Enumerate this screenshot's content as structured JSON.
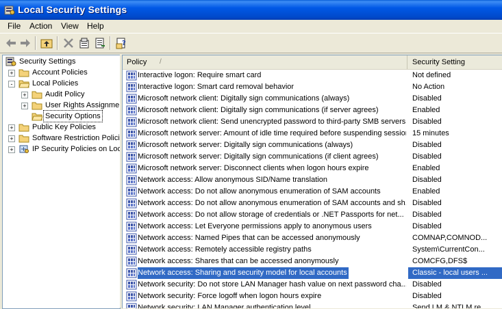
{
  "window": {
    "title": "Local Security Settings"
  },
  "menu": [
    "File",
    "Action",
    "View",
    "Help"
  ],
  "toolbar": [
    "back-icon",
    "forward-icon",
    "up-one-level-icon",
    "delete-icon",
    "properties-icon",
    "export-list-icon",
    "help-icon"
  ],
  "tree": [
    {
      "label": "Security Settings",
      "level": 0,
      "expander": ""
    },
    {
      "label": "Account Policies",
      "level": 1,
      "expander": "+"
    },
    {
      "label": "Local Policies",
      "level": 1,
      "expander": "-"
    },
    {
      "label": "Audit Policy",
      "level": 2,
      "expander": "+"
    },
    {
      "label": "User Rights Assignment",
      "level": 2,
      "expander": "+"
    },
    {
      "label": "Security Options",
      "level": 2,
      "expander": "",
      "selected": true
    },
    {
      "label": "Public Key Policies",
      "level": 1,
      "expander": "+"
    },
    {
      "label": "Software Restriction Policies",
      "level": 1,
      "expander": "+"
    },
    {
      "label": "IP Security Policies on Local Computer",
      "level": 1,
      "expander": "+"
    }
  ],
  "list": {
    "columns": {
      "policy": "Policy",
      "sort_indicator": "/",
      "setting": "Security Setting"
    },
    "rows": [
      {
        "policy": "Interactive logon: Require smart card",
        "setting": "Not defined"
      },
      {
        "policy": "Interactive logon: Smart card removal behavior",
        "setting": "No Action"
      },
      {
        "policy": "Microsoft network client: Digitally sign communications (always)",
        "setting": "Disabled"
      },
      {
        "policy": "Microsoft network client: Digitally sign communications (if server agrees)",
        "setting": "Enabled"
      },
      {
        "policy": "Microsoft network client: Send unencrypted password to third-party SMB servers",
        "setting": "Disabled"
      },
      {
        "policy": "Microsoft network server: Amount of idle time required before suspending session",
        "setting": "15 minutes"
      },
      {
        "policy": "Microsoft network server: Digitally sign communications (always)",
        "setting": "Disabled"
      },
      {
        "policy": "Microsoft network server: Digitally sign communications (if client agrees)",
        "setting": "Disabled"
      },
      {
        "policy": "Microsoft network server: Disconnect clients when logon hours expire",
        "setting": "Enabled"
      },
      {
        "policy": "Network access: Allow anonymous SID/Name translation",
        "setting": "Disabled"
      },
      {
        "policy": "Network access: Do not allow anonymous enumeration of SAM accounts",
        "setting": "Enabled"
      },
      {
        "policy": "Network access: Do not allow anonymous enumeration of SAM accounts and sh...",
        "setting": "Disabled"
      },
      {
        "policy": "Network access: Do not allow storage of credentials or .NET Passports for net...",
        "setting": "Disabled"
      },
      {
        "policy": "Network access: Let Everyone permissions apply to anonymous users",
        "setting": "Disabled"
      },
      {
        "policy": "Network access: Named Pipes that can be accessed anonymously",
        "setting": "COMNAP,COMNOD..."
      },
      {
        "policy": "Network access: Remotely accessible registry paths",
        "setting": "System\\CurrentCon..."
      },
      {
        "policy": "Network access: Shares that can be accessed anonymously",
        "setting": "COMCFG,DFS$"
      },
      {
        "policy": "Network access: Sharing and security model for local accounts",
        "setting": "Classic - local users ...",
        "selected": true
      },
      {
        "policy": "Network security: Do not store LAN Manager hash value on next password cha...",
        "setting": "Disabled"
      },
      {
        "policy": "Network security: Force logoff when logon hours expire",
        "setting": "Disabled"
      },
      {
        "policy": "Network security: LAN Manager authentication level",
        "setting": "Send LM & NTLM re..."
      }
    ]
  },
  "colors": {
    "titlebar": "#0058e6",
    "selection": "#316ac5",
    "window_bg": "#ece9d8"
  }
}
